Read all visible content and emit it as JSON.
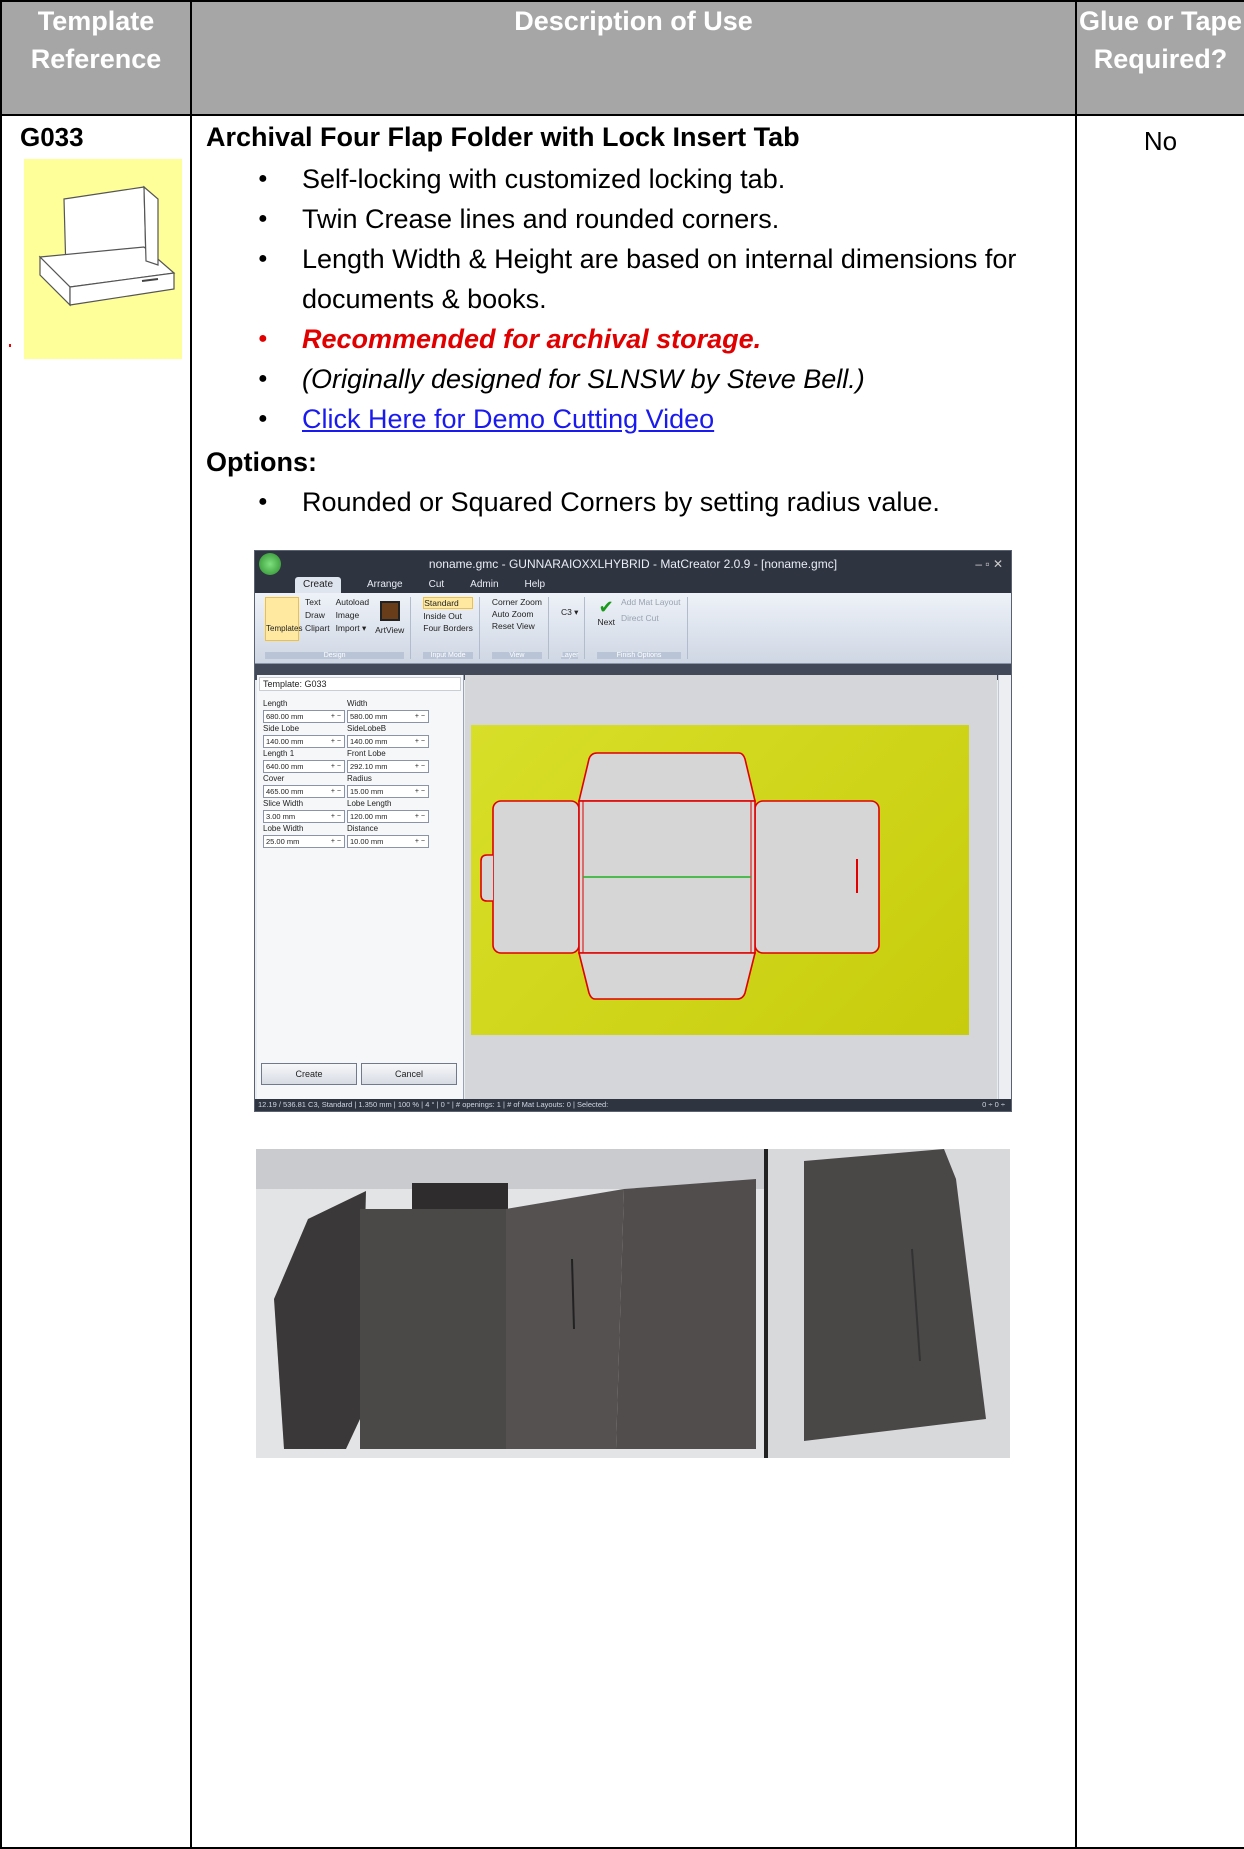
{
  "table": {
    "header": {
      "col1": "Template Reference",
      "col2": "Description of Use",
      "col3": "Glue or Tape Required?"
    },
    "row": {
      "ref": "G033",
      "title": "Archival Four Flap Folder with Lock Insert Tab",
      "bullets": [
        "Self-locking with customized locking tab.",
        "Twin Crease lines and rounded corners.",
        "Length Width & Height are based on internal dimensions for documents & books."
      ],
      "recommended": "Recommended for archival storage.",
      "credit": "(Originally designed for SLNSW by Steve Bell.)",
      "video_link": "Click Here for Demo Cutting Video",
      "options_label": "Options:",
      "options": [
        "Rounded or Squared Corners by setting radius value."
      ],
      "glue": "No"
    }
  },
  "software": {
    "window_title": "noname.gmc - GUNNARAIOXXLHYBRID - MatCreator 2.0.9 - [noname.gmc]",
    "menu_tabs": [
      "Create",
      "Arrange",
      "Cut",
      "Admin",
      "Help"
    ],
    "ribbon": {
      "templates": "Templates",
      "text": "Text",
      "autoload": "Autoload",
      "draw": "Draw",
      "image": "Image",
      "clipart": "Clipart",
      "import": "Import ▾",
      "artview": "ArtView",
      "design_group": "Design",
      "standard": "Standard",
      "inside_out": "Inside Out",
      "four_borders": "Four Borders",
      "input_group": "Input Mode",
      "corner_zoom": "Corner Zoom",
      "auto_zoom": "Auto Zoom",
      "reset_view": "Reset View",
      "view_group": "View",
      "layer": "C3 ▾",
      "layer_group": "Layer",
      "next": "Next",
      "add_mat_layout": "Add Mat Layout",
      "direct_cut": "Direct Cut",
      "finish_group": "Finish Options"
    },
    "template_label": "Template: G033",
    "fields": [
      {
        "label": "Length",
        "value": "680.00 mm"
      },
      {
        "label": "Width",
        "value": "580.00 mm"
      },
      {
        "label": "Side Lobe",
        "value": "140.00 mm"
      },
      {
        "label": "SideLobeB",
        "value": "140.00 mm"
      },
      {
        "label": "Length 1",
        "value": "640.00 mm"
      },
      {
        "label": "Front Lobe",
        "value": "292.10 mm"
      },
      {
        "label": "Cover",
        "value": "465.00 mm"
      },
      {
        "label": "Radius",
        "value": "15.00 mm"
      },
      {
        "label": "Slice Width",
        "value": "3.00 mm"
      },
      {
        "label": "Lobe Length",
        "value": "120.00 mm"
      },
      {
        "label": "Lobe Width",
        "value": "25.00 mm"
      },
      {
        "label": "Distance",
        "value": "10.00 mm"
      }
    ],
    "create_btn": "Create",
    "cancel_btn": "Cancel",
    "status": "12.19 / 536.81    C3, Standard | 1.350 mm | 100 % | 4 ° | 0 ° | # openings: 1 | # of Mat Layouts: 0 | Selected:",
    "status_right": "0 ÷    0 ÷"
  },
  "colors": {
    "header_bg": "#a6a6a6",
    "thumb_bg": "#ffff99",
    "recommended": "#e00000",
    "link": "#1a1aee",
    "canvas_yellow": "#d0d61a",
    "cut_line": "#e00000",
    "dim_line": "#22b022"
  }
}
